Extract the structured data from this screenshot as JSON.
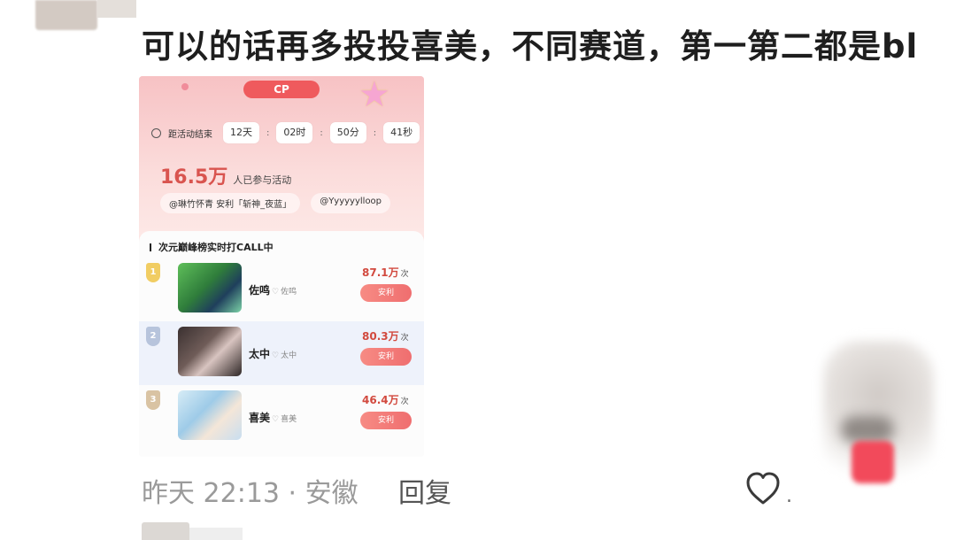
{
  "comment": {
    "text": "可以的话再多投投喜美，不同赛道，第一第二都是bl",
    "time": "昨天 22:13 · 安徽",
    "reply_label": "回复"
  },
  "screenshot": {
    "tag": "CP",
    "countdown": {
      "label": "距活动结束",
      "days": "12天",
      "hours": "02时",
      "minutes": "50分",
      "seconds": "41秒"
    },
    "participants": {
      "count": "16.5万",
      "label": "人已参与活动"
    },
    "ticker": [
      "@琳竹怀青 安利「斩神_夜蓝」",
      "@Yyyyyylloop"
    ],
    "rank_title": "次元巅峰榜实时打CALL中",
    "ranks": [
      {
        "rank": "1",
        "name": "佐鸣",
        "sub": "佐鸣",
        "votes": "87.1万",
        "unit": "次",
        "button": "安利"
      },
      {
        "rank": "2",
        "name": "太中",
        "sub": "太中",
        "votes": "80.3万",
        "unit": "次",
        "button": "安利"
      },
      {
        "rank": "3",
        "name": "喜美",
        "sub": "喜美",
        "votes": "46.4万",
        "unit": "次",
        "button": "安利"
      }
    ]
  },
  "icons": {
    "like": "heart-outline-icon",
    "clock": "clock-icon"
  },
  "colors": {
    "accent": "#ef5a5d",
    "vote_text": "#d24a3f"
  }
}
